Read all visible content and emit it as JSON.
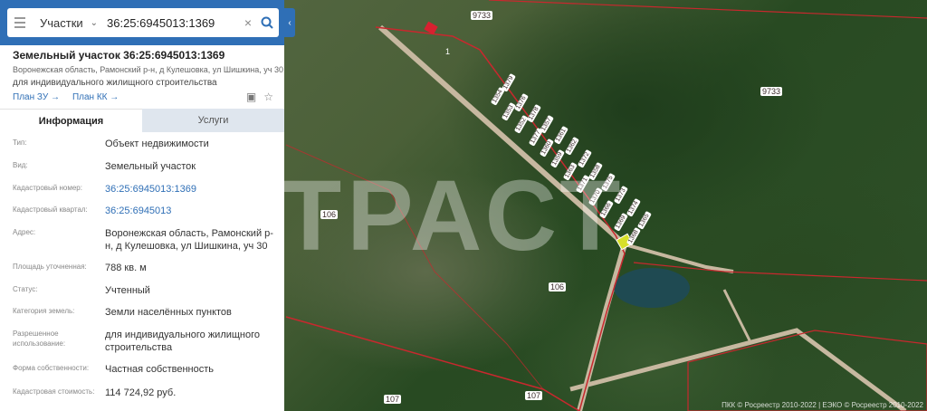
{
  "search": {
    "category": "Участки",
    "query": "36:25:6945013:1369"
  },
  "parcel": {
    "title": "Земельный участок 36:25:6945013:1369",
    "address": "Воронежская область, Рамонский р-н, д Кулешовка, ул Шишкина, уч 30",
    "purpose": "для индивидуального жилищного строительства",
    "links": [
      "План ЗУ →",
      "План КК →"
    ]
  },
  "tabs": [
    "Информация",
    "Услуги"
  ],
  "details": [
    {
      "key": "Тип:",
      "value": "Объект недвижимости"
    },
    {
      "key": "Вид:",
      "value": "Земельный участок"
    },
    {
      "key": "Кадастровый номер:",
      "value": "36:25:6945013:1369"
    },
    {
      "key": "Кадастровый квартал:",
      "value": "36:25:6945013"
    },
    {
      "key": "Адрес:",
      "value": "Воронежская область, Рамонский р-н, д Кулешовка, ул Шишкина, уч 30"
    },
    {
      "key": "Площадь уточненная:",
      "value": "788 кв. м"
    },
    {
      "key": "Статус:",
      "value": "Учтенный"
    },
    {
      "key": "Категория земель:",
      "value": "Земли населённых пунктов"
    },
    {
      "key": "Разрешенное использование:",
      "value": "для индивидуального жилищного строительства"
    },
    {
      "key": "Форма собственности:",
      "value": "Частная собственность"
    },
    {
      "key": "Кадастровая стоимость:",
      "value": "114 724,92 руб."
    }
  ],
  "map": {
    "watermark": "ТРАСТ",
    "labels": [
      "9733",
      "9733",
      "106",
      "106",
      "107",
      "107",
      "1"
    ],
    "plots": [
      "1379",
      "1354",
      "1376",
      "1353",
      "1378",
      "1352",
      "1357",
      "1377",
      "1361",
      "1360",
      "1362",
      "1359",
      "1372",
      "1363",
      "1358",
      "1371",
      "1375",
      "1370",
      "1373",
      "1366",
      "1374",
      "1369",
      "1365",
      "1368"
    ],
    "copyright": "ПКК © Росреестр 2010-2022 | ЕЭКО © Росреестр 2010-2022"
  }
}
